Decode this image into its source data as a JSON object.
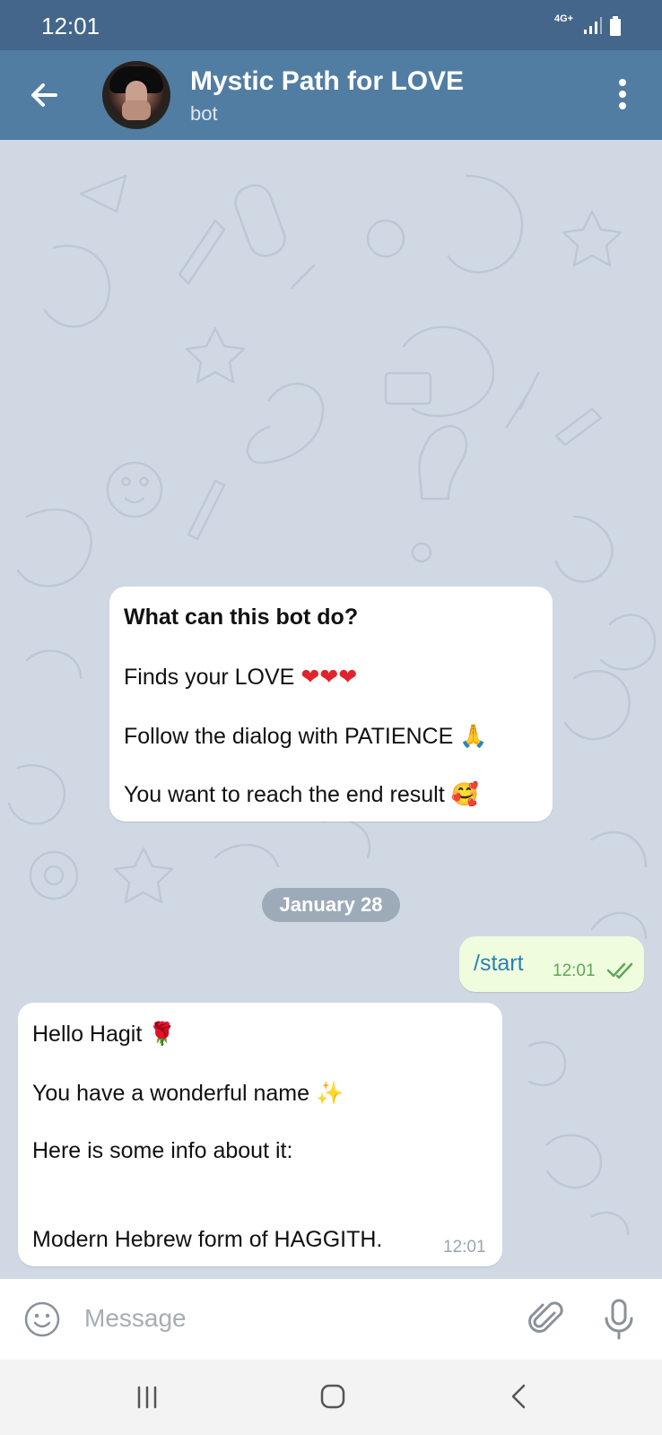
{
  "status_bar": {
    "time": "12:01",
    "network": "4G+"
  },
  "header": {
    "title": "Mystic Path for LOVE",
    "subtitle": "bot",
    "back_icon": "arrow-left-icon",
    "menu_icon": "more-vertical-icon"
  },
  "info_card": {
    "heading": "What can this bot do?",
    "line1": "Finds your LOVE",
    "line1_emoji": "❤❤❤",
    "line2": "Follow the dialog with PATIENCE",
    "line2_emoji": "🙏",
    "line3": "You want to reach the end result",
    "line3_emoji": "🥰"
  },
  "date_separator": "January 28",
  "messages": [
    {
      "direction": "outgoing",
      "text": "/start",
      "time": "12:01",
      "status": "read"
    },
    {
      "direction": "incoming",
      "line1": "Hello Hagit",
      "line1_emoji": "🌹",
      "line2": "You have a wonderful name",
      "line2_emoji": "✨",
      "line3": "Here is some info about it:",
      "line4": "Modern Hebrew form of HAGGITH.",
      "time": "12:01"
    }
  ],
  "input": {
    "placeholder": "Message"
  },
  "colors": {
    "header": "#517da2",
    "status_bar": "#44668a",
    "chat_background": "#d0d9e3",
    "outgoing_bubble": "#effdde"
  }
}
